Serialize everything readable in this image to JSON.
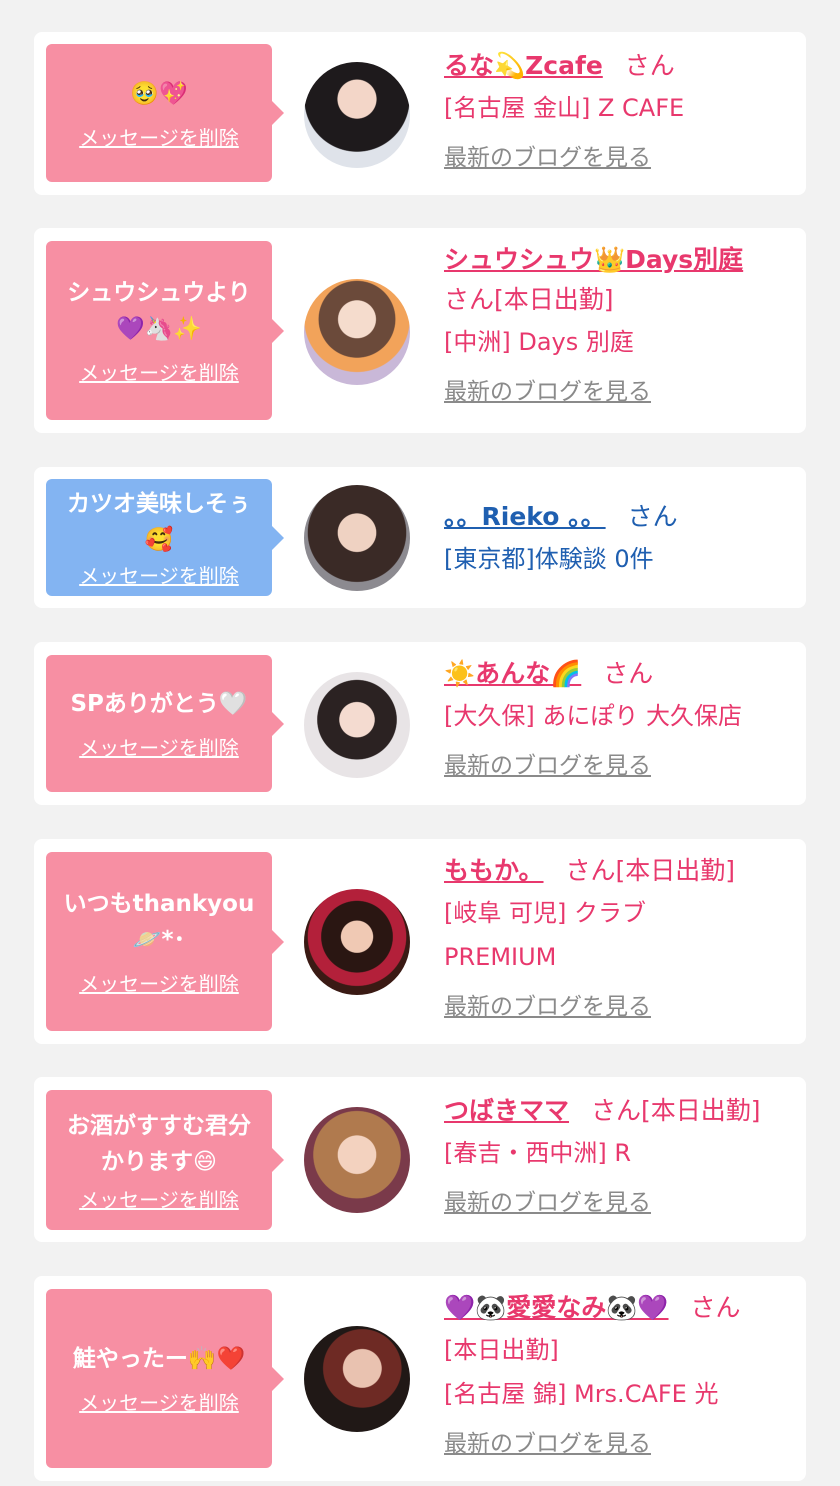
{
  "cards": [
    {
      "message": "🥹💖",
      "delete_label": "メッセージを削除",
      "name": "るな💫Zcafe",
      "san": "さん",
      "lines": [
        "[名古屋 金山] Z CAFE"
      ],
      "blog": "最新のブログを見る",
      "theme": "pink"
    },
    {
      "message": "シュウシュウより\n💜🦄✨",
      "delete_label": "メッセージを削除",
      "name": "シュウシュウ👑Days別庭",
      "san": "さん[本日出勤]",
      "lines": [
        "[中洲] Days 別庭"
      ],
      "blog": "最新のブログを見る",
      "theme": "pink"
    },
    {
      "message": "カツオ美味しそぅ\n🥰",
      "delete_label": "メッセージを削除",
      "name": "。。Rieko 。。",
      "san": "さん",
      "lines": [
        "[東京都]体験談 0件"
      ],
      "blog": "",
      "theme": "blue"
    },
    {
      "message": "SPありがとう🤍",
      "delete_label": "メッセージを削除",
      "name": "☀️あんな🌈",
      "san": "さん",
      "lines": [
        "[大久保] あにぽり 大久保店"
      ],
      "blog": "最新のブログを見る",
      "theme": "pink"
    },
    {
      "message": "いつもthankyou\n🪐*･",
      "delete_label": "メッセージを削除",
      "name": "ももか。",
      "san": "さん[本日出勤]",
      "lines": [
        "[岐阜 可児] クラブ",
        "PREMIUM"
      ],
      "blog": "最新のブログを見る",
      "theme": "pink"
    },
    {
      "message": "お酒がすすむ君分\nかります😄",
      "delete_label": "メッセージを削除",
      "name": "つばきママ",
      "san": "さん[本日出勤]",
      "lines": [
        "[春吉・西中洲] R"
      ],
      "blog": "最新のブログを見る",
      "theme": "pink"
    },
    {
      "message": "鮭やったー🙌❤️",
      "delete_label": "メッセージを削除",
      "name": "💜🐼愛愛なみ🐼💜",
      "san": "さん",
      "lines": [
        "[本日出勤]",
        "[名古屋 錦] Mrs.CAFE 光"
      ],
      "blog": "最新のブログを見る",
      "theme": "pink"
    }
  ]
}
